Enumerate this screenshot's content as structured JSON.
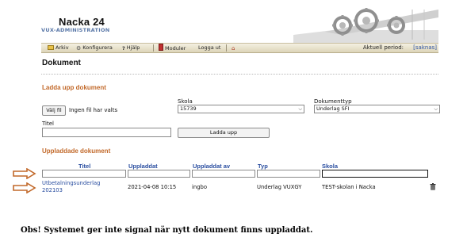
{
  "header": {
    "title": "Nacka 24",
    "subtitle": "VUX-ADMINISTRATION"
  },
  "menu": {
    "items": [
      {
        "label": "Arkiv",
        "icon": "folder-icon"
      },
      {
        "label": "Konfigurera",
        "icon": "gear-icon"
      },
      {
        "label": "Hjälp",
        "icon": "question-icon"
      },
      {
        "label": "Moduler",
        "icon": "module-icon"
      },
      {
        "label": "Logga ut",
        "icon": ""
      },
      {
        "label": "",
        "icon": "home-icon"
      }
    ],
    "period_label": "Aktuell period:",
    "period_value": "[saknas]"
  },
  "page": {
    "title": "Dokument"
  },
  "upload": {
    "section_title": "Ladda upp dokument",
    "file_button": "Välj fil",
    "file_status": "Ingen fil har valts",
    "school_label": "Skola",
    "school_value": "15739",
    "doctype_label": "Dokumenttyp",
    "doctype_value": "Underlag SFI",
    "title_label": "Titel",
    "title_value": "",
    "upload_button": "Ladda upp"
  },
  "uploaded": {
    "section_title": "Uppladdade dokument",
    "columns": [
      "Titel",
      "Uppladdat",
      "Uppladdat av",
      "Typ",
      "Skola"
    ],
    "filters": [
      "",
      "",
      "",
      "",
      ""
    ],
    "rows": [
      {
        "title_line1": "Utbetalningsunderlag",
        "title_line2": "202103",
        "uploaded": "2021-04-08 10:15",
        "uploaded_by": "ingbo",
        "type": "Underlag VUXGY",
        "school": "TEST-skolan i Nacka"
      }
    ]
  },
  "colors": {
    "section_orange": "#c2692a",
    "link_blue": "#2a4ea0",
    "arrow_orange": "#c2692a"
  },
  "note": "Obs! Systemet ger inte signal när nytt dokument finns uppladdat."
}
